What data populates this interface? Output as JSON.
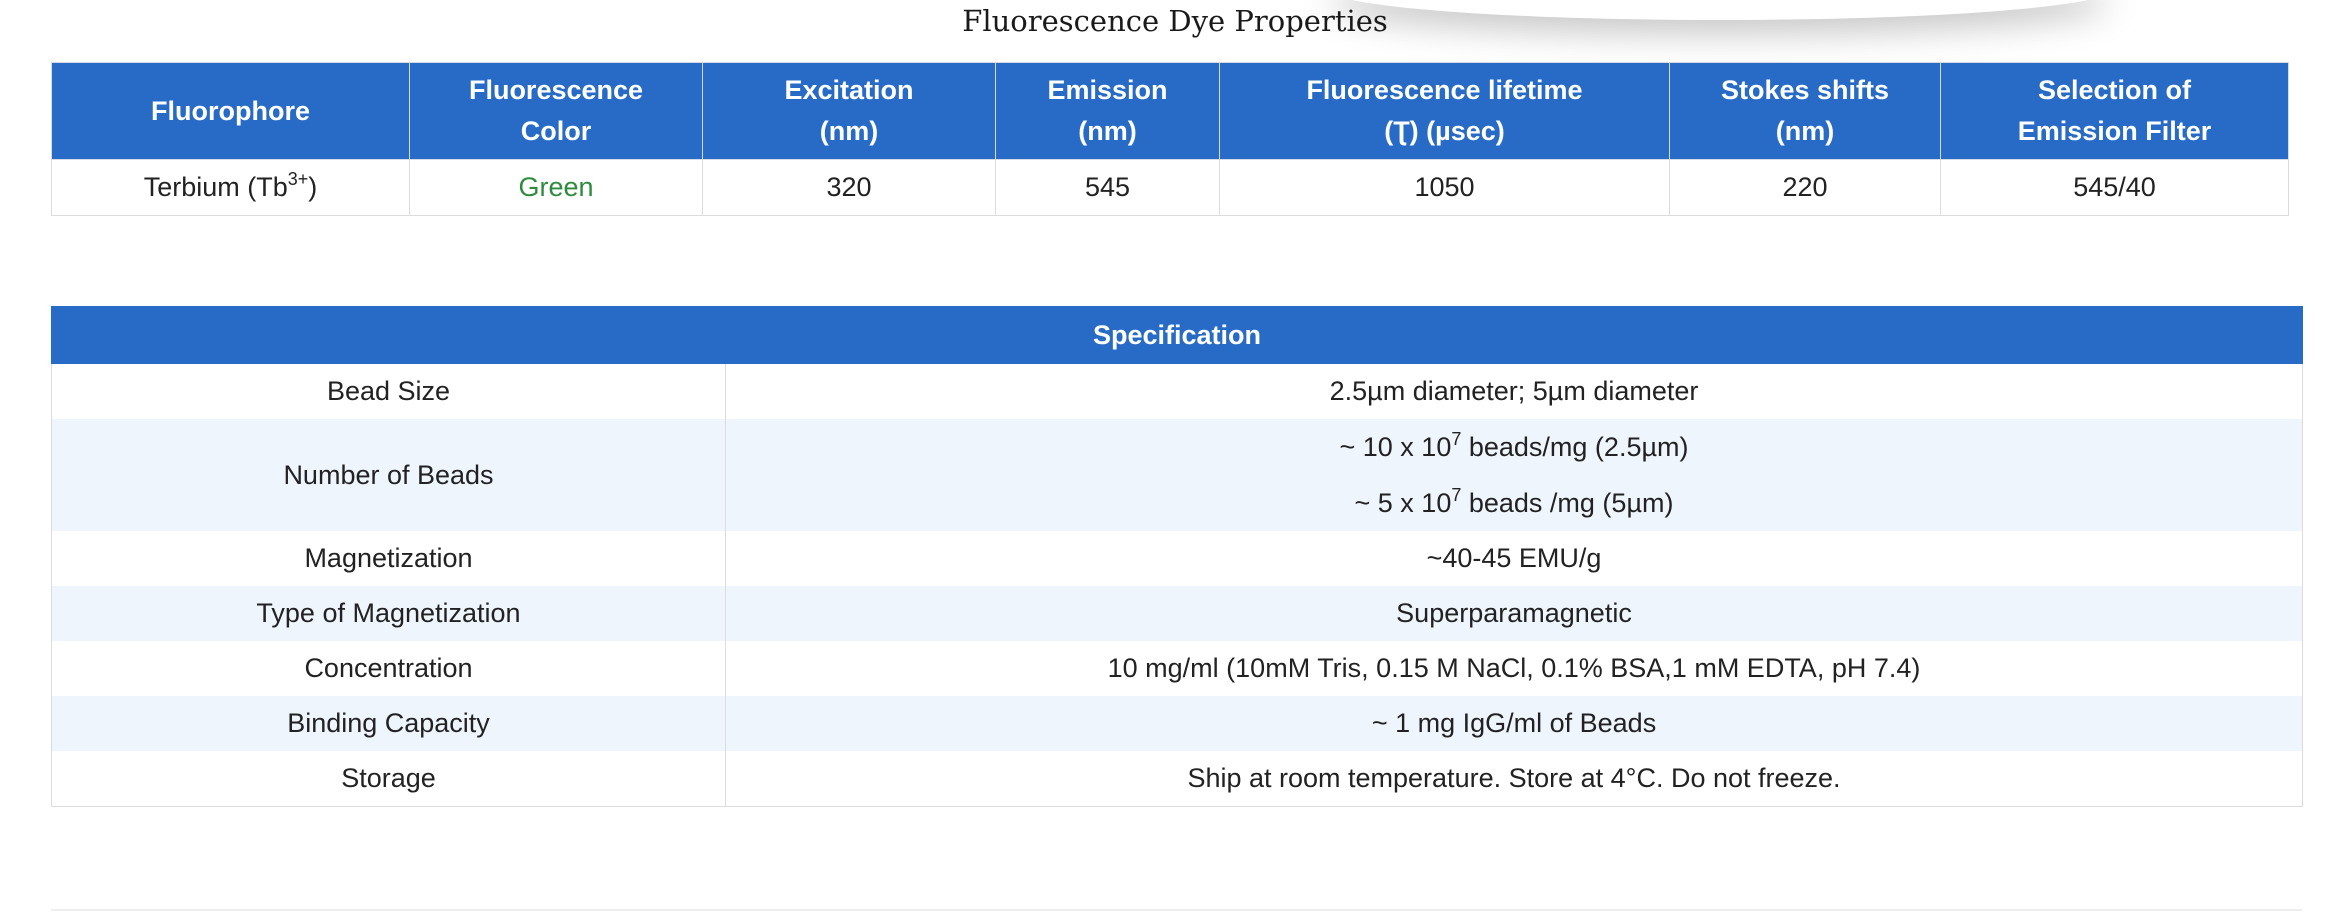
{
  "page_title": "Fluorescence Dye Properties",
  "dye_table": {
    "headers": [
      [
        "Fluorophore"
      ],
      [
        "Fluorescence",
        "Color"
      ],
      [
        "Excitation",
        "(nm)"
      ],
      [
        "Emission",
        "(nm)"
      ],
      [
        "Fluorescence lifetime",
        "(Ʈ) (µsec)"
      ],
      [
        "Stokes shifts",
        "(nm)"
      ],
      [
        "Selection of",
        "Emission Filter"
      ]
    ],
    "row": {
      "fluorophore": "Terbium (Tb",
      "fluorophore_sup": "3+",
      "fluorophore_close": ")",
      "color": "Green",
      "excitation": "320",
      "emission": "545",
      "lifetime": "1050",
      "stokes": "220",
      "filter": "545/40"
    }
  },
  "spec_table": {
    "header": "Specification",
    "rows": {
      "bead_size": {
        "label": "Bead Size",
        "value": "2.5µm diameter; 5µm diameter"
      },
      "number_of_beads": {
        "label": "Number of Beads",
        "line1_pre": "~ 10 x 10",
        "line1_sup": "7",
        "line1_post": " beads/mg (2.5µm)",
        "line2_pre": "~ 5 x 10",
        "line2_sup": "7",
        "line2_post": " beads /mg (5µm)"
      },
      "magnetization": {
        "label": "Magnetization",
        "value": "~40-45 EMU/g"
      },
      "type_of_magnetization": {
        "label": "Type of Magnetization",
        "value": "Superparamagnetic"
      },
      "concentration": {
        "label": "Concentration",
        "value": "10 mg/ml (10mM Tris, 0.15 M NaCl, 0.1% BSA,1 mM EDTA, pH 7.4)"
      },
      "binding_capacity": {
        "label": "Binding Capacity",
        "value": "~ 1 mg IgG/ml of Beads"
      },
      "storage": {
        "label": "Storage",
        "value": "Ship at room temperature. Store at 4°C. Do not freeze."
      }
    }
  },
  "colors": {
    "header_blue": "#276bc7",
    "row_tint": "#eef5fd",
    "green_text": "#2e8b3d"
  }
}
